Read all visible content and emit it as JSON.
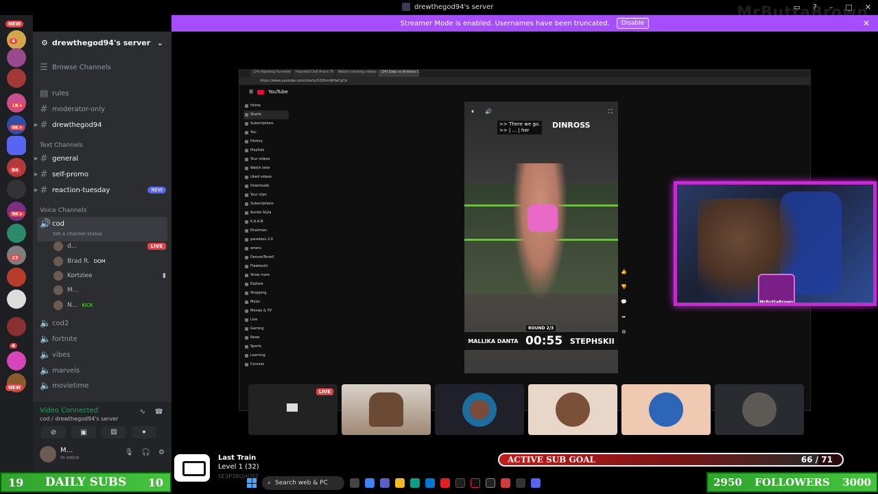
{
  "window": {
    "title": "drewthegod94's server",
    "watermark": "MrButtaBrown"
  },
  "banner": {
    "text": "Streamer Mode is enabled. Usernames have been truncated.",
    "disable_label": "Disable"
  },
  "rail": {
    "badges": [
      "NEW",
      "4",
      "1K+",
      "9K+",
      "84",
      "9K+",
      "23",
      "67",
      "4",
      "NEW"
    ]
  },
  "sidebar": {
    "server_name": "drewthegod94's server",
    "browse": "Browse Channels",
    "top_channels": [
      "rules",
      "moderator-only",
      "drewthegod94"
    ],
    "text_category": "Text Channels",
    "text_channels": [
      "general",
      "self-promo",
      "reaction-tuesday"
    ],
    "new_badge": "NEW",
    "voice_category": "Voice Channels",
    "cod": {
      "name": "cod",
      "status": "Set a channel status"
    },
    "voice_users": [
      {
        "name": "d...",
        "tag": "LIVE"
      },
      {
        "name": "Brad R.",
        "tag": "DOM"
      },
      {
        "name": "Kortziee",
        "tag": ""
      },
      {
        "name": "M...",
        "tag": ""
      },
      {
        "name": "N...",
        "tag": "KICK"
      }
    ],
    "other_voice": [
      "cod2",
      "fortnite",
      "vibes",
      "marvels",
      "movietime"
    ]
  },
  "voice_panel": {
    "title": "Video Connected",
    "sub": "cod / drewthegod94's server"
  },
  "user_panel": {
    "name": "M...",
    "status": "In voice"
  },
  "shared_screen": {
    "tabs": [
      "(24) Ranking Funniest Summit Th",
      "Haunted Doll Prank That Will So",
      "Watch trending videos for you |",
      "(24) Dabi vs Kristina Castro"
    ],
    "url": "https://www.youtube.com/shorts/X2DhmWrfwCg?si",
    "yt_brand": "YouTube",
    "nav": [
      "Home",
      "Shorts",
      "Subscriptions",
      "You",
      "History",
      "Playlists",
      "Your videos",
      "Watch later",
      "Liked videos",
      "Downloads",
      "Your clips",
      "Subscriptions",
      "Auntie Styla",
      "K.A.A.N.",
      "Khairman",
      "paradoxx 2.0",
      "ameru",
      "DevvonTerrell",
      "Flawlesshi",
      "Show more",
      "Explore",
      "Shopping",
      "Music",
      "Movies & TV",
      "Live",
      "Gaming",
      "News",
      "Sports",
      "Learning",
      "Courses"
    ],
    "caption": ">> There we go.\n>> | ... | her",
    "name_overlay": "DINROSS",
    "round": "ROUND 2/3",
    "left_name": "MALLIKA DANTA",
    "clock": "00:55",
    "right_name": "STEPHSKII"
  },
  "tiles": {
    "live": "LIVE"
  },
  "overlay": {
    "sub_goal_label": "ACTIVE SUB GOAL",
    "sub_goal_count": "66 / 71",
    "sub_goal_fraction": 0.93,
    "daily_subs_left": "19",
    "daily_subs_label": "DAILY SUBS",
    "daily_subs_right": "10",
    "followers_left": "2950",
    "followers_label": "FOLLOWERS",
    "followers_right": "3000",
    "now_playing_title": "Last Train",
    "now_playing_level": "Level 1  (32)",
    "now_playing_ghost": "SE3P3RGHOST"
  },
  "taskbar": {
    "search_placeholder": "Search web & PC"
  }
}
